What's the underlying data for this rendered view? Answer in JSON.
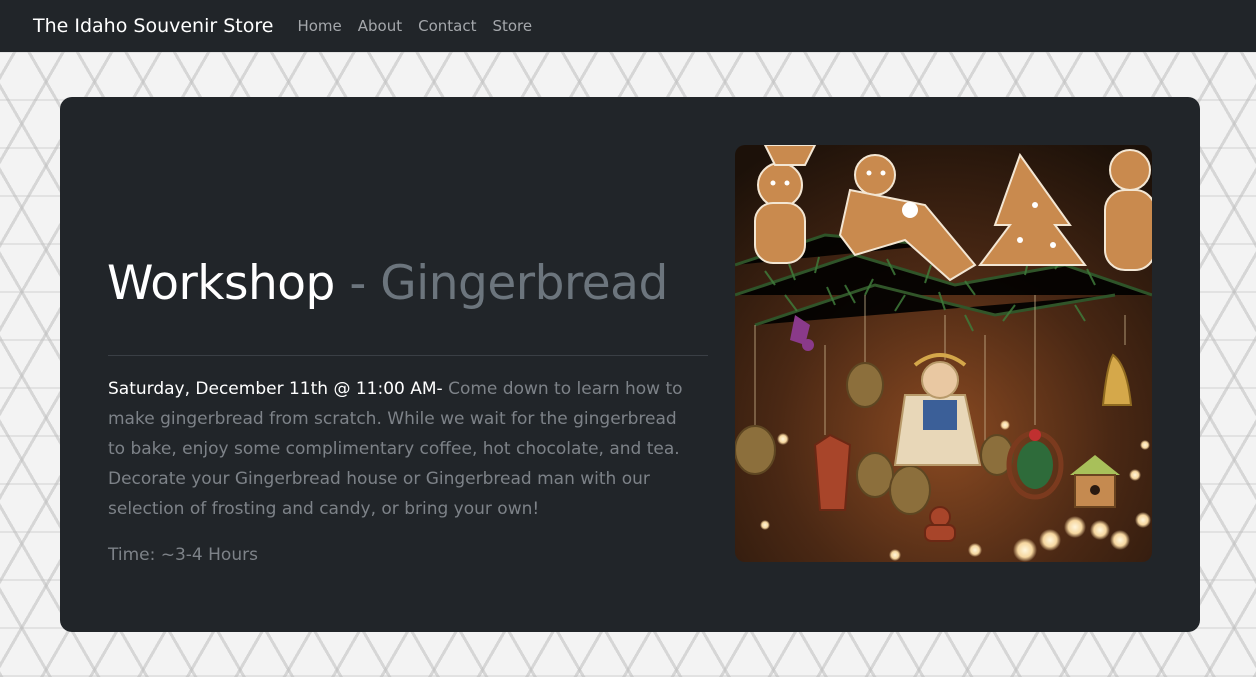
{
  "navbar": {
    "brand": "The Idaho Souvenir Store",
    "links": [
      "Home",
      "About",
      "Contact",
      "Store"
    ]
  },
  "workshop": {
    "title": "Workshop",
    "separator": "-",
    "subtitle": "Gingerbread",
    "date": "Saturday, December 11th @ 11:00 AM-",
    "description": " Come down to learn how to make gingerbread from scratch. While we wait for the gingerbread to bake, enjoy some complimentary coffee, hot chocolate, and tea. Decorate your Gingerbread house or Gingerbread man with our selection of frosting and candy, or bring your own!",
    "duration": "Time: ~3-4 Hours"
  },
  "colors": {
    "navbar_bg": "#212529",
    "card_bg": "#212529",
    "muted_text": "#6c757d"
  }
}
